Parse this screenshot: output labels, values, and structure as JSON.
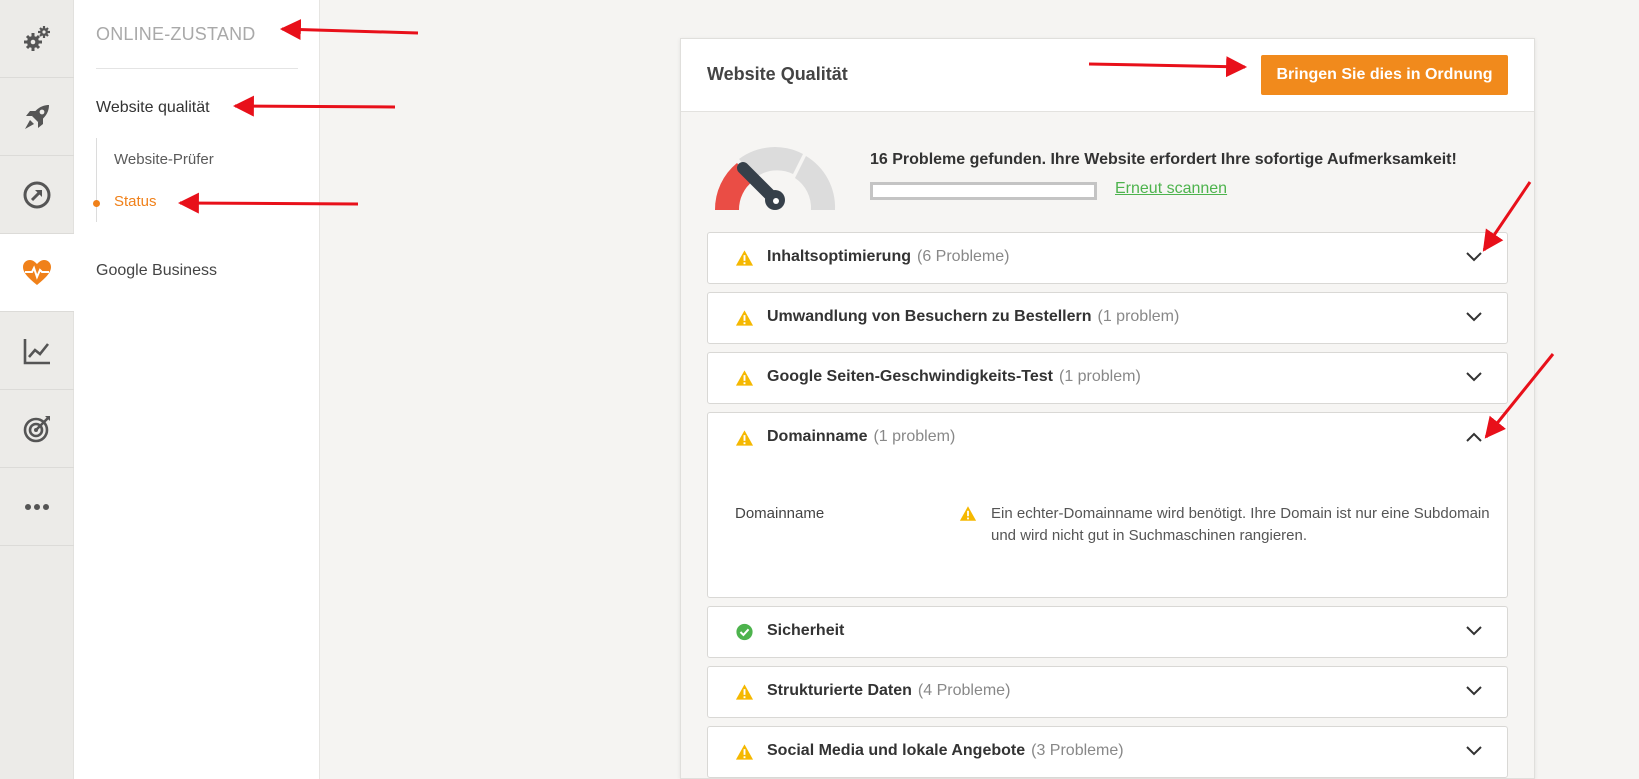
{
  "rail": {
    "items": [
      {
        "icon": "gears-icon",
        "active": false
      },
      {
        "icon": "rocket-icon",
        "active": false
      },
      {
        "icon": "gauge-arrow-icon",
        "active": false
      },
      {
        "icon": "heartbeat-icon",
        "active": true
      },
      {
        "icon": "line-chart-icon",
        "active": false
      },
      {
        "icon": "target-icon",
        "active": false
      },
      {
        "icon": "more-dots-icon",
        "active": false
      }
    ],
    "accent_color": "#f0811a"
  },
  "subnav": {
    "title": "ONLINE-ZUSTAND",
    "section_label": "Website qualität",
    "children": [
      {
        "label": "Website-Prüfer",
        "active": false
      },
      {
        "label": "Status",
        "active": true
      }
    ],
    "google_label": "Google Business"
  },
  "card": {
    "title": "Website Qualität",
    "fix_button_label": "Bringen Sie dies in Ordnung",
    "fix_button_color": "#f18a1c",
    "summary_text": "16 Probleme gefunden. Ihre Website erfordert Ihre sofortige Aufmerksamkeit!",
    "rescan_label": "Erneut scannen",
    "gauge_level": "low",
    "sections": [
      {
        "label": "Inhaltsoptimierung",
        "count": "(6 Probleme)",
        "status": "warning-icon",
        "expanded": false
      },
      {
        "label": "Umwandlung von Besuchern zu Bestellern",
        "count": "(1 problem)",
        "status": "warning-icon",
        "expanded": false
      },
      {
        "label": "Google Seiten-Geschwindigkeits-Test",
        "count": "(1 problem)",
        "status": "warning-icon",
        "expanded": false
      },
      {
        "label": "Domainname",
        "count": "(1 problem)",
        "status": "warning-icon",
        "expanded": true,
        "details": [
          {
            "name": "Domainname",
            "text": "Ein echter-Domainname wird benötigt. Ihre Domain ist nur eine Subdomain und wird nicht gut in Suchmaschinen rangieren."
          }
        ]
      },
      {
        "label": "Sicherheit",
        "count": "",
        "status": "check-icon",
        "expanded": false
      },
      {
        "label": "Strukturierte Daten",
        "count": "(4 Probleme)",
        "status": "warning-icon",
        "expanded": false
      },
      {
        "label": "Social Media und lokale Angebote",
        "count": "(3 Probleme)",
        "status": "warning-icon",
        "expanded": false
      }
    ],
    "colors": {
      "warning": "#f5b800",
      "success": "#4db34d",
      "annotation": "#e8101a"
    }
  }
}
